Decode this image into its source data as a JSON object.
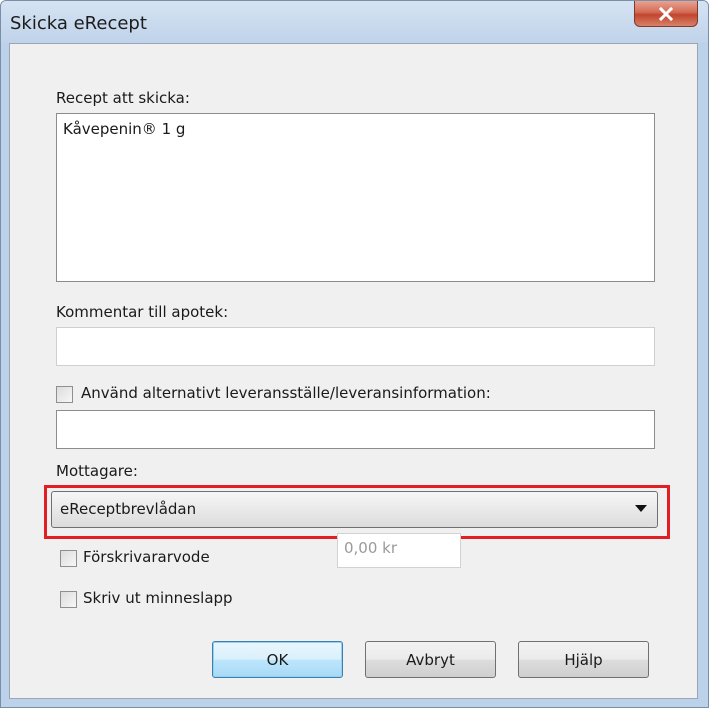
{
  "dialog": {
    "title": "Skicka eRecept",
    "recipes_label": "Recept att skicka:",
    "recipes": [
      "Kåvepenin® 1 g"
    ],
    "comment_label": "Kommentar till apotek:",
    "comment_value": "",
    "alt_delivery": {
      "label": "Använd alternativt leveransställe/leveransinformation:",
      "checked": false,
      "value": ""
    },
    "recipient_label": "Mottagare:",
    "recipient_selected": "eReceptbrevlådan",
    "fee": {
      "label": "Förskrivararvode",
      "checked": false,
      "value": "0,00 kr"
    },
    "print_reminder": {
      "label": "Skriv ut minneslapp",
      "checked": false
    },
    "buttons": {
      "ok": "OK",
      "cancel": "Avbryt",
      "help": "Hjälp"
    }
  },
  "colors": {
    "highlight": "#e01e24",
    "close_button": "#c7553d"
  }
}
